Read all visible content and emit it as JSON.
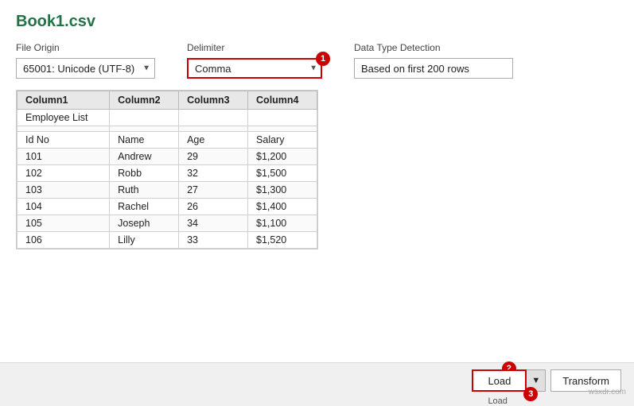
{
  "title": "Book1.csv",
  "fileOrigin": {
    "label": "File Origin",
    "value": "65001: Unicode (UTF-8)"
  },
  "delimiter": {
    "label": "Delimiter",
    "value": "Comma",
    "badge": "1"
  },
  "dataTypeDetection": {
    "label": "Data Type Detection",
    "value": "Based on first 200 rows"
  },
  "table": {
    "headers": [
      "Column1",
      "Column2",
      "Column3",
      "Column4"
    ],
    "rows": [
      [
        "Employee List",
        "",
        "",
        ""
      ],
      [
        "",
        "",
        "",
        ""
      ],
      [
        "Id No",
        "Name",
        "Age",
        "Salary"
      ],
      [
        "101",
        "Andrew",
        "29",
        "$1,200"
      ],
      [
        "102",
        "Robb",
        "32",
        "$1,500"
      ],
      [
        "103",
        "Ruth",
        "27",
        "$1,300"
      ],
      [
        "104",
        "Rachel",
        "26",
        "$1,400"
      ],
      [
        "105",
        "Joseph",
        "34",
        "$1,100"
      ],
      [
        "106",
        "Lilly",
        "33",
        "$1,520"
      ]
    ]
  },
  "bottomBar": {
    "loadLabel": "Load",
    "loadBadge": "2",
    "transformLabel": "Transform",
    "loadDropdownLabel": "Load",
    "badge3": "3",
    "watermark": "wsxdr.com"
  }
}
